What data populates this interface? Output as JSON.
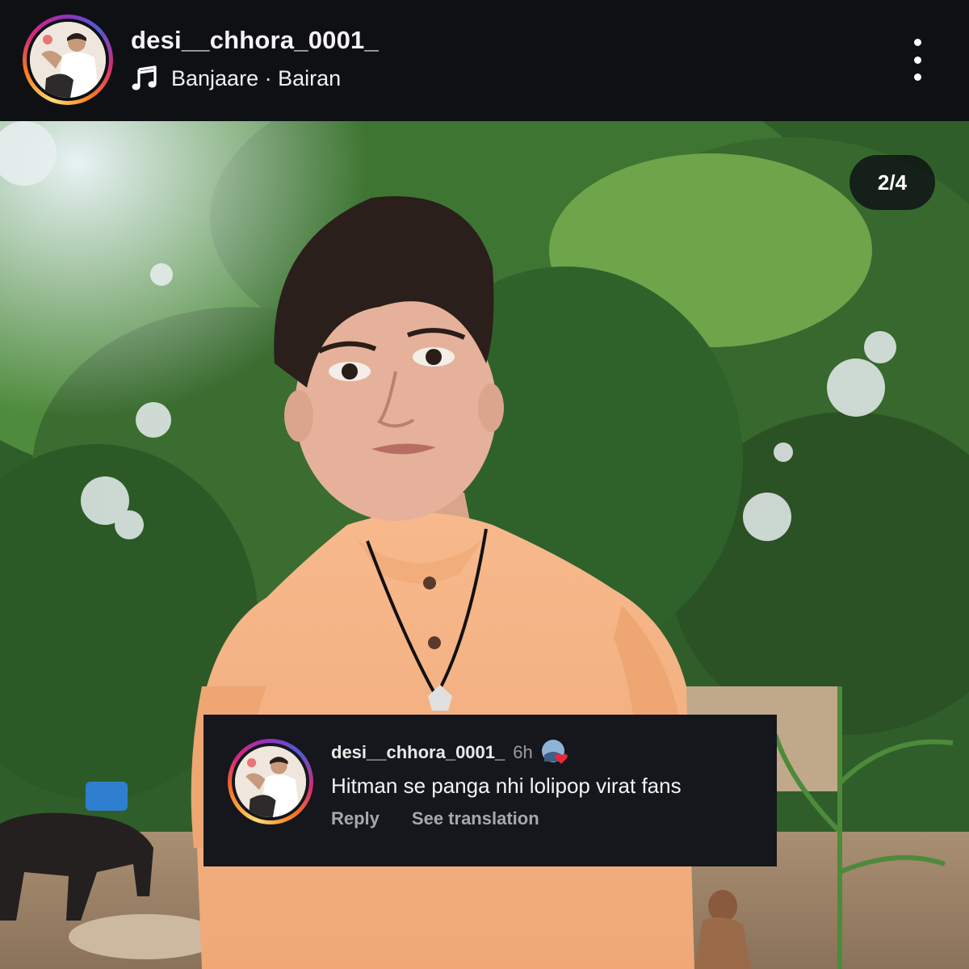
{
  "header": {
    "username": "desi__chhora_0001_",
    "music_label": "Banjaare · Bairan",
    "avatar_icon": "profile-avatar",
    "music_icon": "music-note-icon",
    "menu_icon": "more-vertical-icon"
  },
  "media": {
    "counter": "2/4"
  },
  "comment": {
    "username": "desi__chhora_0001_",
    "time": "6h",
    "text": "Hitman se panga nhi lolipop virat fans",
    "reply_label": "Reply",
    "translate_label": "See translation"
  },
  "colors": {
    "background": "#0e1014",
    "ring_accent": "#d62976",
    "heart": "#e8283d"
  }
}
